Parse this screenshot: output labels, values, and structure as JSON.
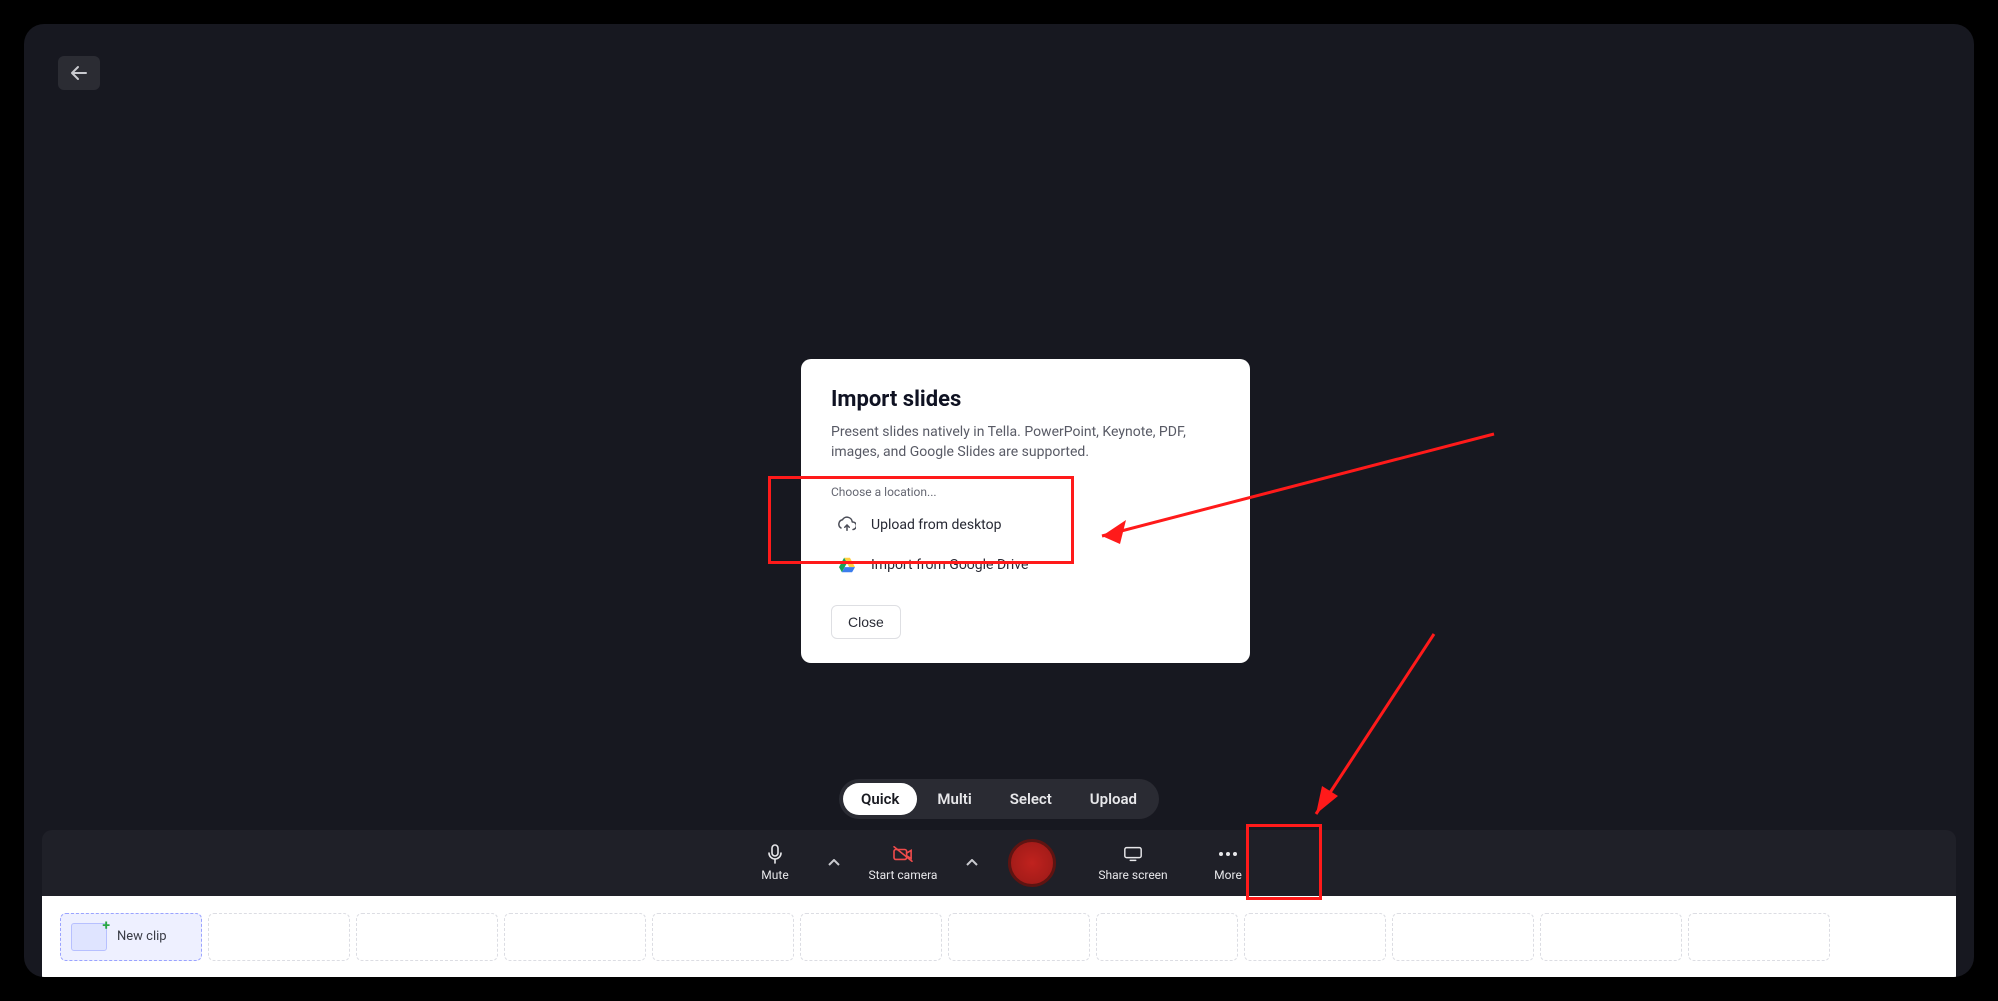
{
  "header": {
    "back_aria": "Back"
  },
  "modal": {
    "title": "Import slides",
    "description": "Present slides natively in Tella. PowerPoint, Keynote, PDF, images, and Google Slides are supported.",
    "choose_label": "Choose a location...",
    "options": {
      "upload_desktop": "Upload from desktop",
      "import_gdrive": "Import from Google Drive"
    },
    "close_label": "Close"
  },
  "mode_segments": {
    "quick": "Quick",
    "multi": "Multi",
    "select": "Select",
    "upload": "Upload"
  },
  "controls": {
    "mute": "Mute",
    "start_camera": "Start camera",
    "share_screen": "Share screen",
    "more": "More"
  },
  "clip_strip": {
    "new_clip": "New clip"
  }
}
